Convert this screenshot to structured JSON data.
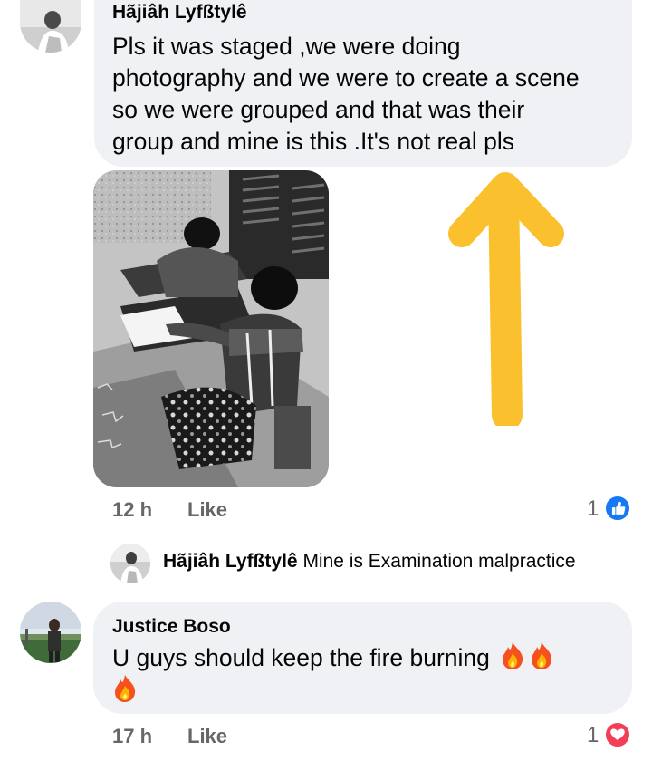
{
  "comment1": {
    "author": "Hãjiâh Lyfßtylê",
    "lines": [
      "Pls it was staged ,we were doing",
      "photography and we were to create a scene",
      "so we were grouped and that was their",
      "group and mine is this .It's not real pls"
    ],
    "time": "12 h",
    "like_label": "Like",
    "reaction_count": "1",
    "reaction_icon": "like-icon",
    "reaction_color": "#1877f2",
    "annotation_arrow_color": "#fbc02d"
  },
  "reply_preview": {
    "author": "Hãjiâh Lyfßtylê",
    "text": "Mine is Examination malpractice"
  },
  "comment2": {
    "author": "Justice Boso",
    "line1": "U guys should keep the fire burning",
    "time": "17 h",
    "like_label": "Like",
    "reaction_count": "1",
    "reaction_icon": "love-icon",
    "reaction_color": "#f33e58",
    "emoji": "fire-emoji"
  }
}
